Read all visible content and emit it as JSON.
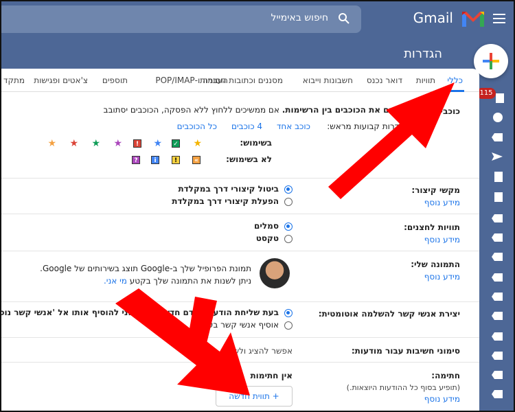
{
  "topbar": {
    "app_name": "Gmail",
    "search_placeholder": "חיפוש באימייל"
  },
  "settings_title": "הגדרות",
  "inbox_badge": "115",
  "tabs": [
    {
      "label": "כללי",
      "active": true
    },
    {
      "label": "תוויות"
    },
    {
      "label": "דואר נכנס"
    },
    {
      "label": "חשבונות וייבוא"
    },
    {
      "label": "מסננים וכתובות חסומות"
    },
    {
      "label": "העברה ו-POP/IMAP"
    },
    {
      "label": "תוספים"
    },
    {
      "label": "צ'אטים ופגישות"
    },
    {
      "label": "מתקד"
    }
  ],
  "stars": {
    "label": "כוכבים:",
    "description_bold": "גוררים את הכוכבים בין הרשימות.",
    "description": " אם ממשיכים ללחוץ ללא הפסקה, הכוכבים יסתובב",
    "presets_label": "הגדרות קבועות מראש:",
    "preset_1": "כוכב אחד",
    "preset_4": "4 כוכבים",
    "preset_all": "כל הכוכבים",
    "in_use_label": "בשימוש:",
    "not_in_use_label": "לא בשימוש:"
  },
  "shortcuts": {
    "label": "מקשי קיצור:",
    "more_info": "מידע נוסף",
    "option_off": "ביטול קיצורי דרך במקלדת",
    "option_on": "הפעלת קיצורי דרך במקלדת"
  },
  "button_labels": {
    "label": "תוויות לחצנים:",
    "more_info": "מידע נוסף",
    "option_icons": "סמלים",
    "option_text": "טקסט"
  },
  "my_picture": {
    "label": "התמונה שלי:",
    "more_info": "מידע נוסף",
    "line1": "תמונת הפרופיל שלך ב-Google תוצג בשירותים של Google.",
    "line2": "ניתן לשנות את התמונה שלך בקטע",
    "line2_link": "מי אני."
  },
  "auto_contacts": {
    "label": "יצירת אנשי קשר להשלמה אוטומטית:",
    "option1": "בעת שליחת הודעה לאדם חדש, ...שר אני להוסיף אותו אל 'אנשי קשר נוספים'",
    "option2": "אוסיף אנשי קשר בע..."
  },
  "importance": {
    "label": "סימוני חשיבות עבור מודעות:",
    "text": "אפשר להציג ולשנות ... כאן."
  },
  "signature": {
    "label": "חתימה:",
    "sublabel": "(תופיע בסוף כל ההודעות היוצאות.)",
    "more_info": "מידע נוסף",
    "no_signatures": "אין חתימות",
    "new_button": "תווית חדשה"
  },
  "colors": {
    "accent": "#1a73e8",
    "topbar": "#4d6796",
    "arrow": "#ff0000"
  }
}
